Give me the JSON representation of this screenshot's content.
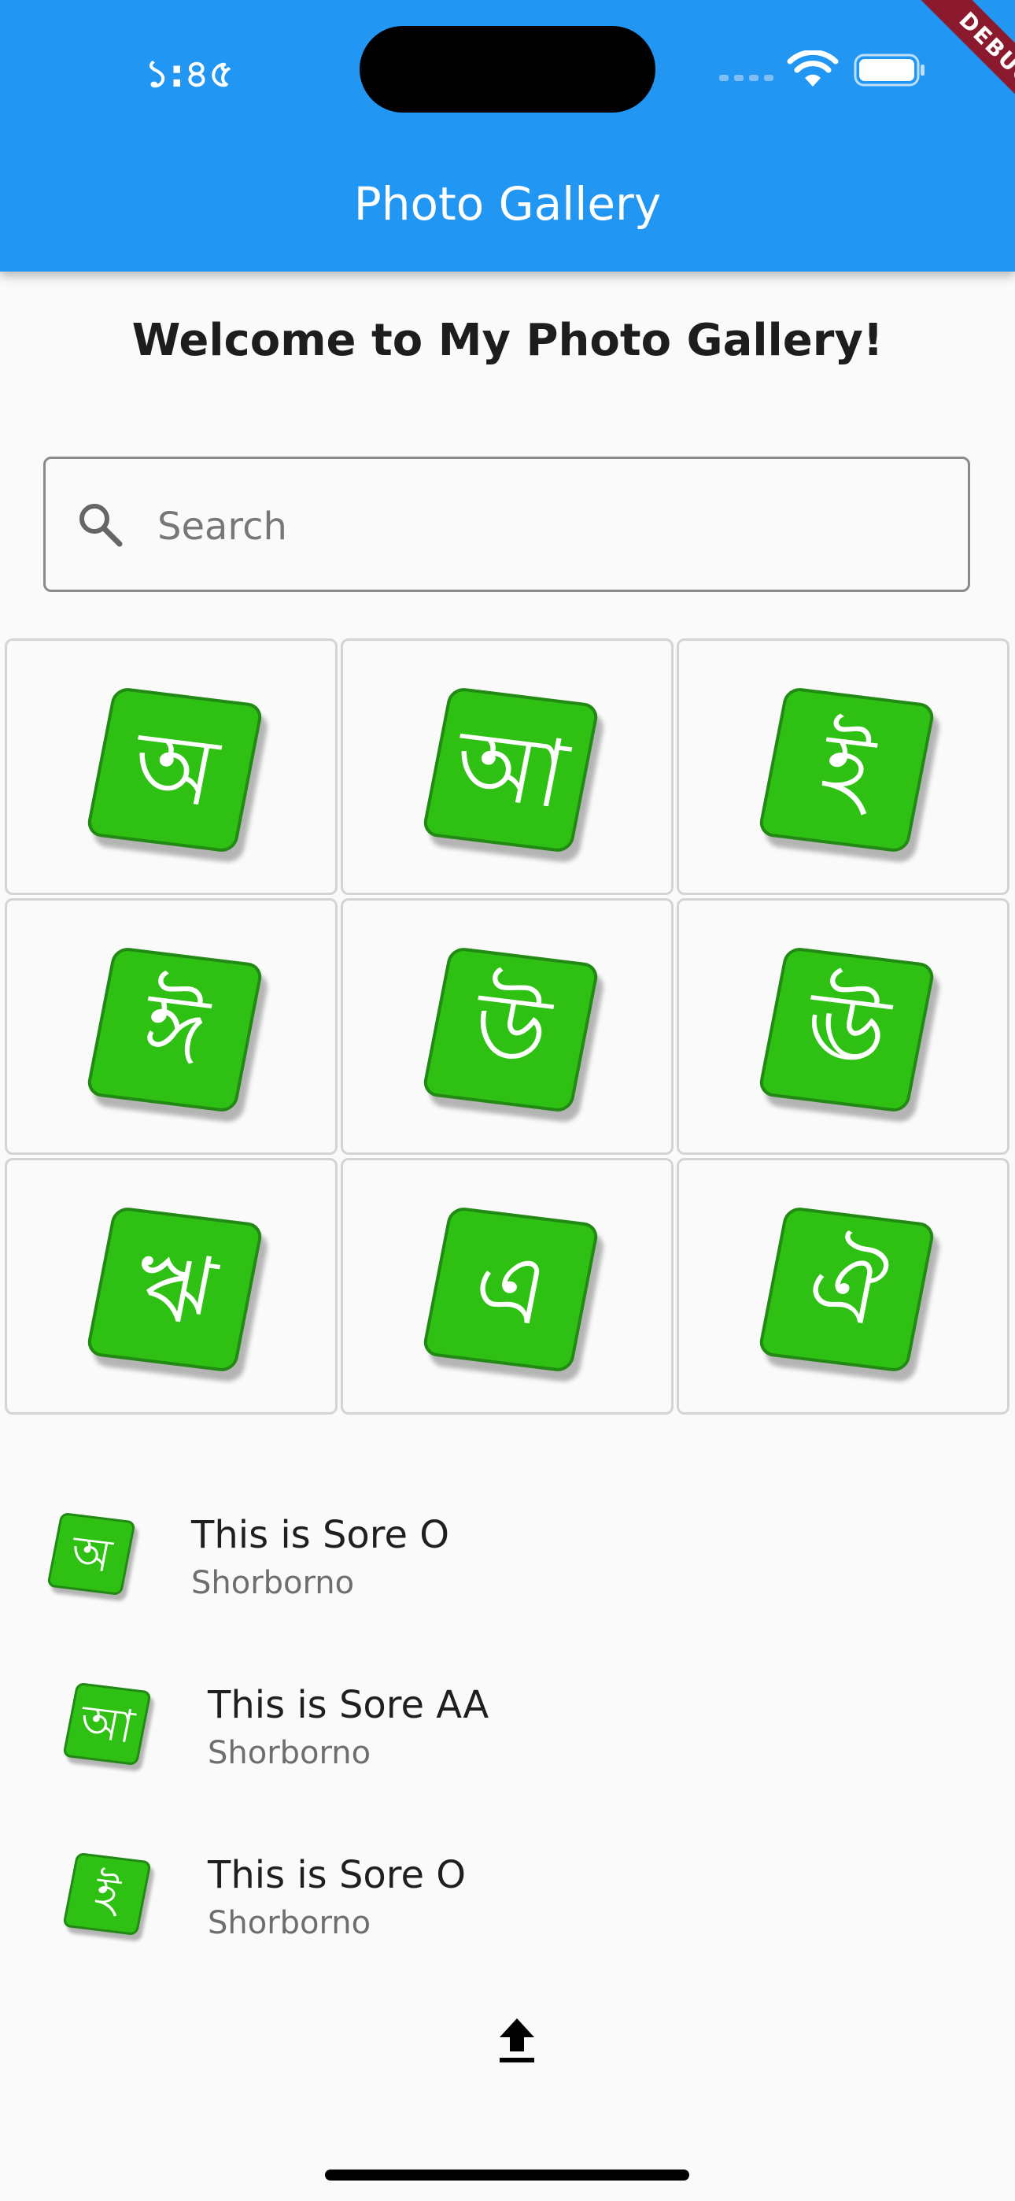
{
  "status_bar": {
    "time": "১:৪৫"
  },
  "debug_banner": "DEBUG",
  "app_bar": {
    "title": "Photo Gallery"
  },
  "welcome": "Welcome to My Photo Gallery!",
  "search": {
    "placeholder": "Search",
    "value": ""
  },
  "grid": [
    {
      "letter": "অ"
    },
    {
      "letter": "আ"
    },
    {
      "letter": "ই"
    },
    {
      "letter": "ঈ"
    },
    {
      "letter": "উ"
    },
    {
      "letter": "ঊ"
    },
    {
      "letter": "ঋ"
    },
    {
      "letter": "এ"
    },
    {
      "letter": "ঐ"
    }
  ],
  "list": [
    {
      "letter": "অ",
      "title": "This is Sore O",
      "subtitle": "Shorborno"
    },
    {
      "letter": "আ",
      "title": "This is Sore AA",
      "subtitle": "Shorborno"
    },
    {
      "letter": "ই",
      "title": "This is Sore O",
      "subtitle": "Shorborno"
    }
  ],
  "icons": {
    "search": "search-icon",
    "upload": "upload-icon",
    "wifi": "wifi-icon",
    "battery": "battery-icon"
  },
  "colors": {
    "app_bar": "#2196F3",
    "tile_green": "#2ec012",
    "tile_border": "#228a14",
    "debug_banner": "#8b1a2e"
  }
}
